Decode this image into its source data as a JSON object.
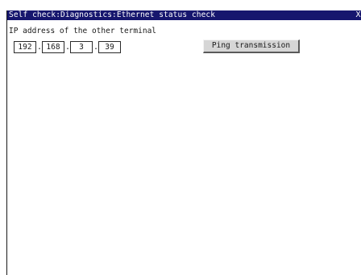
{
  "window": {
    "title": "Self check:Diagnostics:Ethernet status check",
    "close_label": "X"
  },
  "ip_section": {
    "label": "IP address of the other terminal",
    "octets": [
      "192",
      "168",
      "3",
      "39"
    ],
    "separator": "."
  },
  "actions": {
    "ping_label": "Ping transmission"
  },
  "colors": {
    "titlebar_bg": "#16166e",
    "titlebar_text": "#ffffff",
    "button_face": "#d6d6d6"
  }
}
